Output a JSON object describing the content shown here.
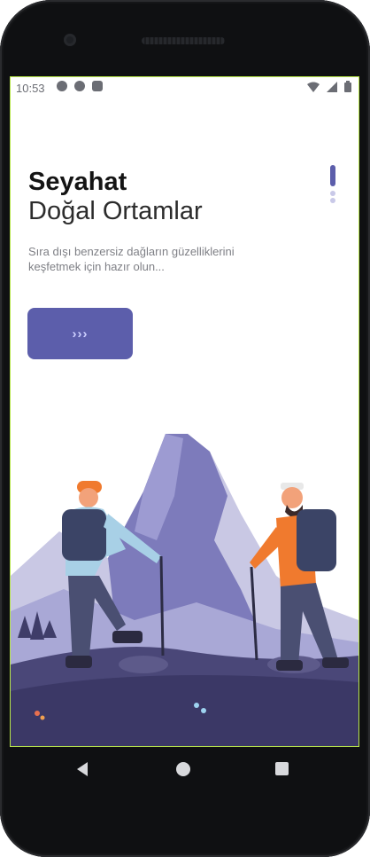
{
  "status_bar": {
    "time": "10:53",
    "left_icons": [
      "settings-icon",
      "play-protect-icon",
      "sd-card-icon"
    ],
    "right_icons": [
      "wifi-icon",
      "signal-icon",
      "battery-icon"
    ]
  },
  "onboarding": {
    "title": "Seyahat",
    "subtitle": "Doğal Ortamlar",
    "description": "Sıra dışı benzersiz dağların güzelliklerini keşfetmek için hazır olun...",
    "next_button_label": "›››",
    "page_indicator": {
      "pages": 3,
      "current": 1
    }
  },
  "nav_bar": {
    "buttons": [
      "back-icon",
      "home-icon",
      "recents-icon"
    ]
  },
  "colors": {
    "accent": "#5c5eab",
    "accent_light": "#c9c9e8",
    "mountain": "#8f8fc6",
    "ground": "#3e3a63",
    "hiker_left_shirt": "#a8d0e6",
    "hiker_right_shirt": "#f07a2e"
  }
}
